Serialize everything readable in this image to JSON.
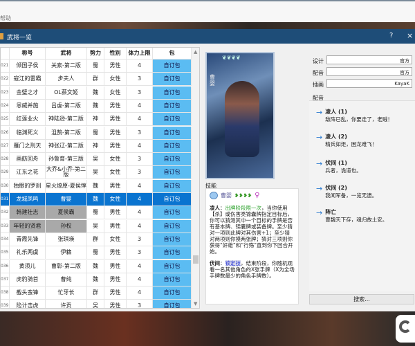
{
  "topbar": {
    "menu": "帮助"
  },
  "dialog": {
    "title": "武将一览",
    "help": "?",
    "close": "×"
  },
  "table": {
    "columns": [
      "称号",
      "武将",
      "势力",
      "性别",
      "体力上限",
      "包"
    ],
    "rows": [
      [
        "021",
        "倾国子侯",
        "关索-第二版",
        "蜀",
        "男性",
        "4",
        "自订包"
      ],
      [
        "022",
        "寇江的雷霸",
        "步夫人",
        "群",
        "女性",
        "3",
        "自订包"
      ],
      [
        "023",
        "金璧之才",
        "OL蔡文姬",
        "魏",
        "女性",
        "3",
        "自订包"
      ],
      [
        "024",
        "恩威并施",
        "吕虔-第二版",
        "魏",
        "男性",
        "4",
        "自订包"
      ],
      [
        "025",
        "红莲业火",
        "神陆逊-第二版",
        "神",
        "男性",
        "4",
        "自订包"
      ],
      [
        "026",
        "临渊死义",
        "沮鹄-第二版",
        "蜀",
        "男性",
        "3",
        "自订包"
      ],
      [
        "027",
        "雁门之刑天",
        "神张辽-第二版",
        "神",
        "男性",
        "4",
        "自订包"
      ],
      [
        "028",
        "画舫回舟",
        "孙鲁育-第三版",
        "吴",
        "女性",
        "3",
        "自订包"
      ],
      [
        "029",
        "江东之花",
        "大乔&小乔-第二版",
        "吴",
        "女性",
        "3",
        "自订包"
      ],
      [
        "030",
        "独眼的罗刹",
        "星火燎原-夏侯惇",
        "魏",
        "男性",
        "4",
        "自订包"
      ],
      [
        "031",
        "龙城凤鸣",
        "曹婴",
        "魏",
        "女性",
        "4",
        "自订包"
      ],
      [
        "032",
        "韩建壮志",
        "夏侯霸",
        "蜀",
        "男性",
        "4",
        "自订包"
      ],
      [
        "033",
        "年轻的贤君",
        "孙权",
        "吴",
        "男性",
        "4",
        "自订包"
      ],
      [
        "034",
        "青霞先锋",
        "张琪瑛",
        "群",
        "女性",
        "3",
        "自订包"
      ],
      [
        "035",
        "礼乐两虞",
        "伊籍",
        "蜀",
        "男性",
        "3",
        "自订包"
      ],
      [
        "036",
        "黄须儿",
        "曹彰-第二版",
        "魏",
        "男性",
        "4",
        "自订包"
      ],
      [
        "037",
        "虎豹骑首",
        "曹纯",
        "魏",
        "男性",
        "4",
        "自订包"
      ],
      [
        "038",
        "截头蛮锋",
        "忙牙长",
        "群",
        "男性",
        "4",
        "自订包"
      ],
      [
        "039",
        "险计击虎",
        "许贡",
        "吴",
        "男性",
        "3",
        "自订包"
      ]
    ],
    "selected_index": 10,
    "gray_rows": [
      11,
      12
    ]
  },
  "card": {
    "name": "曹婴",
    "hp": "4",
    "magatama": "❦❦❦❦"
  },
  "skills": {
    "label": "技能",
    "hero_name": "曹婴",
    "hp_icons": "❥❥❥❥",
    "gender": "♀",
    "items": [
      {
        "name": "凌人",
        "tag": "出牌阶段限一次",
        "text": "，当你使用【杀】或伤害类锦囊牌指定目标后，你可以猜测其中一个目标的手牌是否有基本牌、锦囊牌或装备牌。至少猜对一项则此牌对其伤害+1；至少猜对两项则你摸两张牌；猜对三项则你获得“奸雄”和“行殇”直到你下回合开始。"
      },
      {
        "name": "伏间",
        "tag": "锁定技",
        "text": "，结束阶段，你随机观看一名其他角色的X张手牌（X为全场手牌数最少的角色手牌数）。"
      }
    ]
  },
  "info": {
    "fields": [
      {
        "label": "设计",
        "value": "官方"
      },
      {
        "label": "配音",
        "value": "官方"
      },
      {
        "label": "插画",
        "value": "KayaK"
      }
    ],
    "quotes_label": "配音",
    "quotes": [
      {
        "title": "凌人 (1)",
        "text": "敌阵已乱，你要走了，老贼！"
      },
      {
        "title": "凌人 (2)",
        "text": "精兵如炬，困龙难飞！"
      },
      {
        "title": "伏间 (1)",
        "text": "兵者，诡道也。"
      },
      {
        "title": "伏间 (2)",
        "text": "我闻军备，一览无遗。"
      },
      {
        "title": "阵亡",
        "text": "曹魏天下存，魂归故土安。"
      }
    ],
    "search": "搜索..."
  },
  "colors": {
    "titlebar": "#1e4d78",
    "package_cell": "#5bbcf2",
    "selected_row": "#0a74d0"
  }
}
